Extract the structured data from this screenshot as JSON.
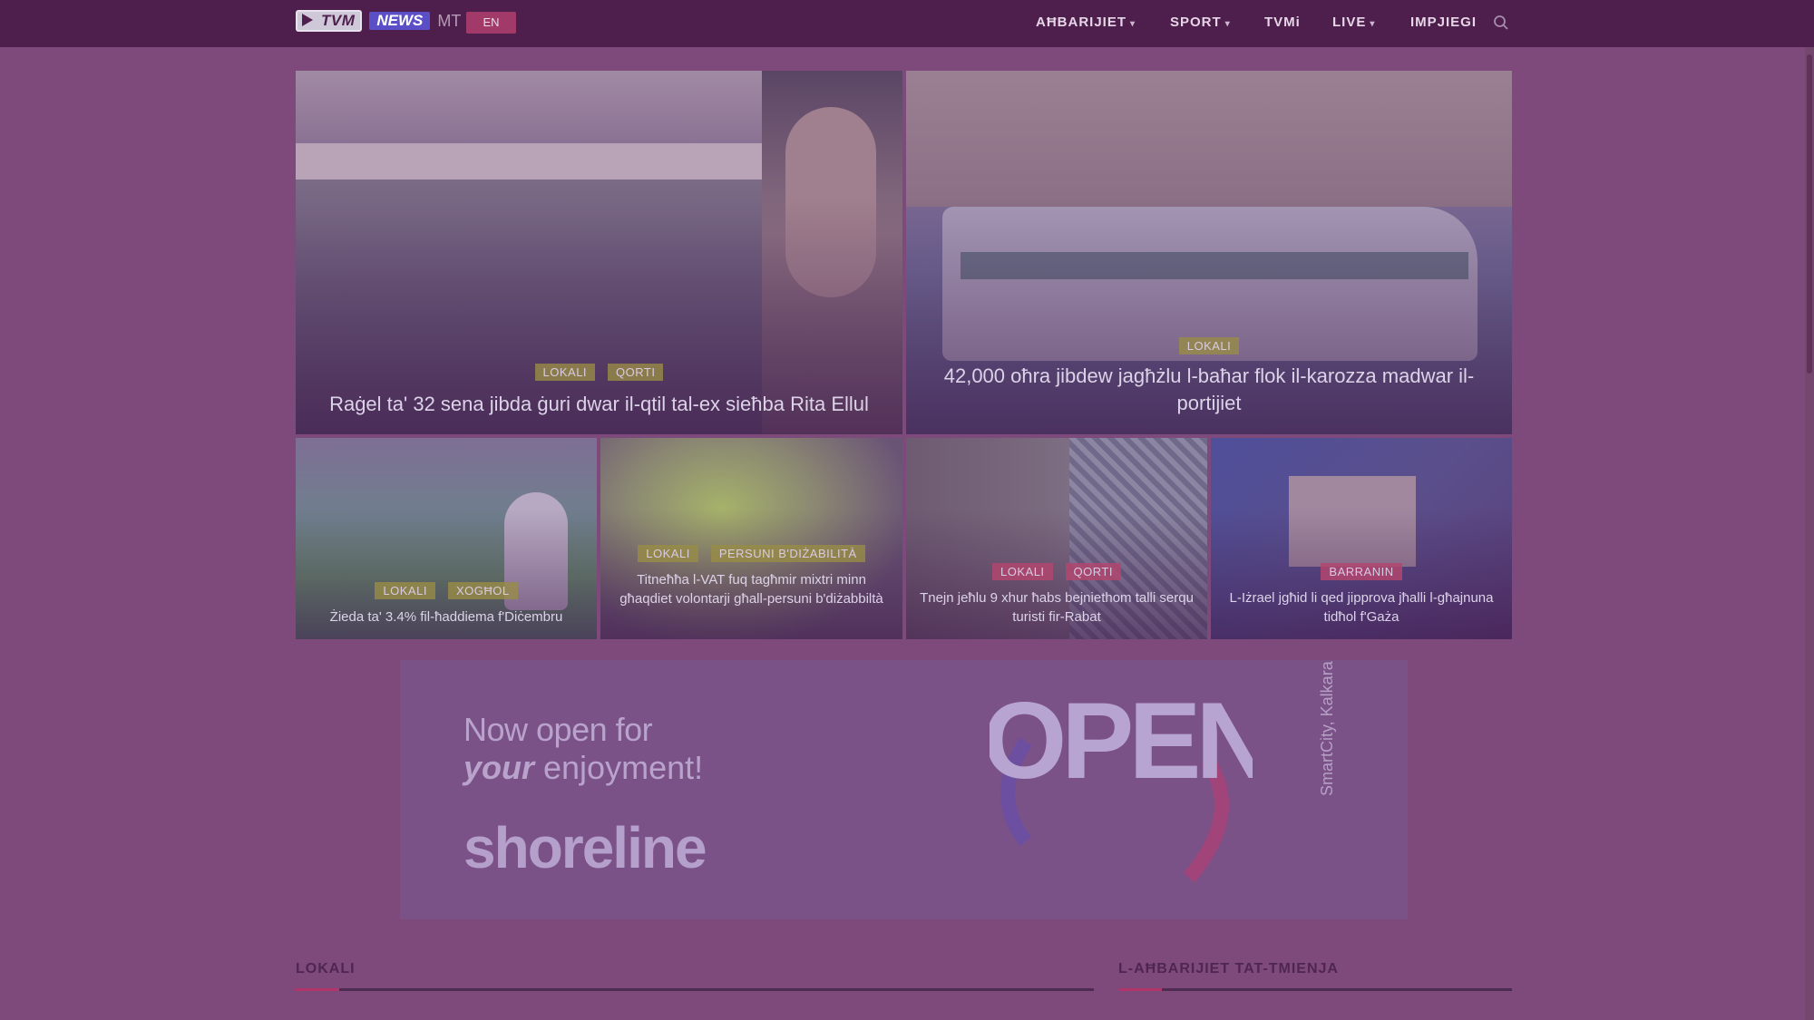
{
  "header": {
    "logo_tvm": "TVM",
    "logo_news": "NEWS",
    "logo_mt": "MT",
    "lang_button": "EN",
    "nav": [
      {
        "label": "AĦBARIJIET",
        "dropdown": true
      },
      {
        "label": "SPORT",
        "dropdown": true
      },
      {
        "label": "TVMi",
        "dropdown": false
      },
      {
        "label": "LIVE",
        "dropdown": true
      },
      {
        "label": "IMPJIEGI",
        "dropdown": false
      }
    ],
    "search_icon": "search-icon"
  },
  "featured": [
    {
      "tags": [
        "LOKALI",
        "QORTI"
      ],
      "title": "Raġel ta' 32 sena jibda ġuri dwar il-qtil tal-ex sieħba Rita Ellul"
    },
    {
      "tags": [
        "LOKALI"
      ],
      "title": "42,000 oħra jibdew jagħżlu l-baħar flok il-karozza madwar il-portijiet"
    }
  ],
  "grid": [
    {
      "tags": [
        "LOKALI",
        "XOGĦOL"
      ],
      "title": "Żieda ta' 3.4% fil-ħaddiema f'Diċembru"
    },
    {
      "tags": [
        "LOKALI",
        "PERSUNI B'DIŻABILITÀ"
      ],
      "title": "Titneħħa l-VAT fuq tagħmir mixtri minn għaqdiet volontarji għall-persuni b'diżabbiltà"
    },
    {
      "tags": [
        "LOKALI",
        "QORTI"
      ],
      "title": "Tnejn jeħlu 9 xhur ħabs bejniethom talli serqu turisti fir-Rabat"
    },
    {
      "tags": [
        "BARRANIN"
      ],
      "title": "L-Iżrael jgħid li qed jipprova jħalli l-għajnuna tidħol f'Gaża"
    }
  ],
  "ad": {
    "line1": "Now open for",
    "line2_bold": "your",
    "line2_rest": " enjoyment!",
    "brand": "shoreline",
    "big_word": "OPEN",
    "side": "SmartCity, Kalkara"
  },
  "sections": {
    "left": "LOKALI",
    "right": "L-AĦBARIJIET TAT-TMIENJA"
  },
  "colors": {
    "header_bg": "#4e1f4c",
    "accent": "#b1356b",
    "lang_button": "#a23a69"
  }
}
